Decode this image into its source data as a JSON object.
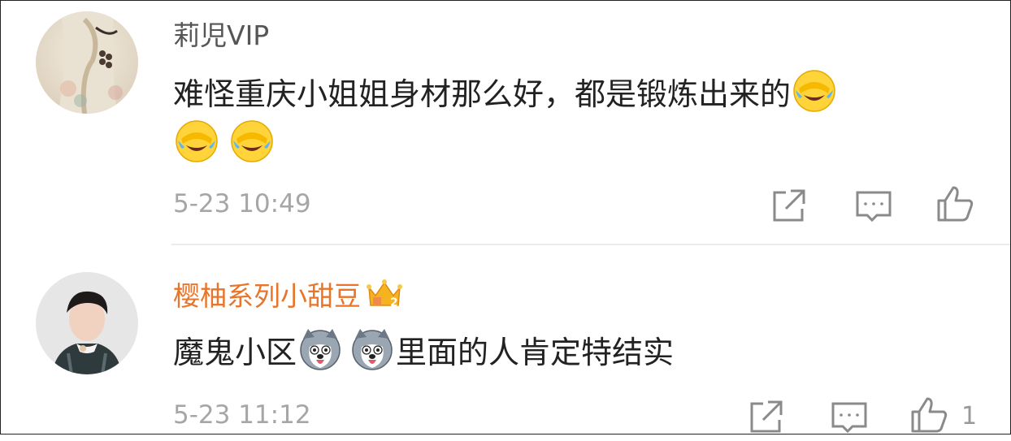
{
  "comments": [
    {
      "username": "莉児VIP",
      "text_parts": [
        "难怪重庆小姐姐身材那么好，都是锻炼出来的"
      ],
      "emoji_names": [
        "laugh-cry-emoji",
        "laugh-cry-emoji",
        "laugh-cry-emoji"
      ],
      "time": "5-23 10:49",
      "likes": ""
    },
    {
      "username": "樱柚系列小甜豆",
      "badge": "crown-level-badge",
      "text_parts": [
        "魔鬼小区",
        "里面的人肯定特结实"
      ],
      "emoji_names": [
        "husky-emoji",
        "husky-emoji"
      ],
      "time": "5-23 11:12",
      "likes": "1"
    }
  ],
  "colors": {
    "vip_name": "#e8752a",
    "name": "#555555",
    "text": "#222222",
    "meta": "#a6a6a6",
    "icon": "#8a8a8a"
  }
}
